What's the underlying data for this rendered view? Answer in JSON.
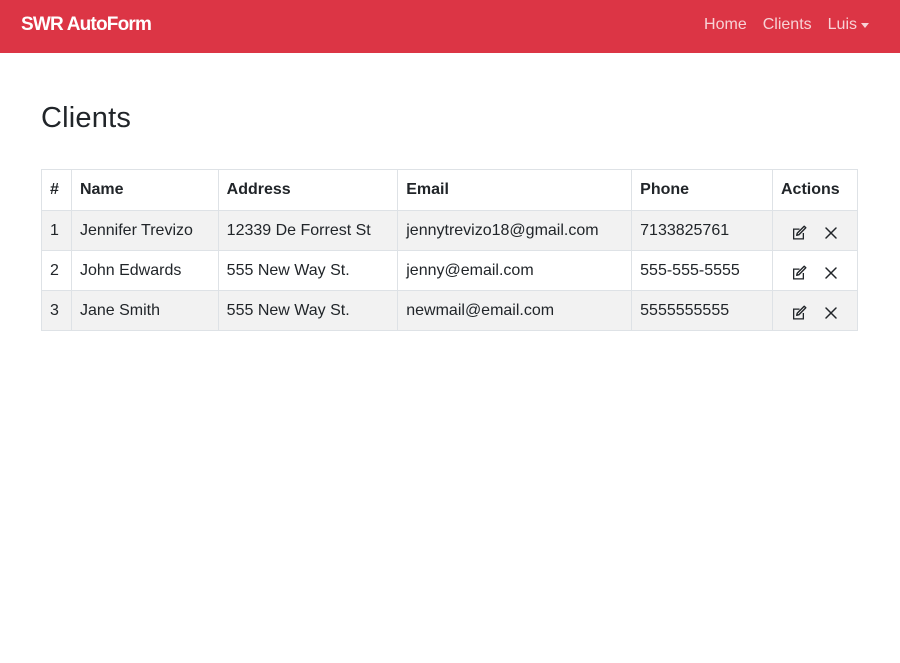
{
  "navbar": {
    "brand": "SWR AutoForm",
    "links": [
      {
        "label": "Home"
      },
      {
        "label": "Clients"
      },
      {
        "label": "Luis"
      }
    ]
  },
  "page": {
    "title": "Clients"
  },
  "table": {
    "headers": [
      "#",
      "Name",
      "Address",
      "Email",
      "Phone",
      "Actions"
    ],
    "rows": [
      {
        "num": "1",
        "name": "Jennifer Trevizo",
        "address": "12339 De Forrest St",
        "email": "jennytrevizo18@gmail.com",
        "phone": "7133825761"
      },
      {
        "num": "2",
        "name": "John Edwards",
        "address": "555 New Way St.",
        "email": "jenny@email.com",
        "phone": "555-555-5555"
      },
      {
        "num": "3",
        "name": "Jane Smith",
        "address": "555 New Way St.",
        "email": "newmail@email.com",
        "phone": "5555555555"
      }
    ],
    "row_icons": [
      "edit-icon",
      "close-icon"
    ]
  },
  "colors": {
    "navbar": "#dc3545",
    "striped_row": "#f2f2f2",
    "border": "#dee2e6"
  }
}
